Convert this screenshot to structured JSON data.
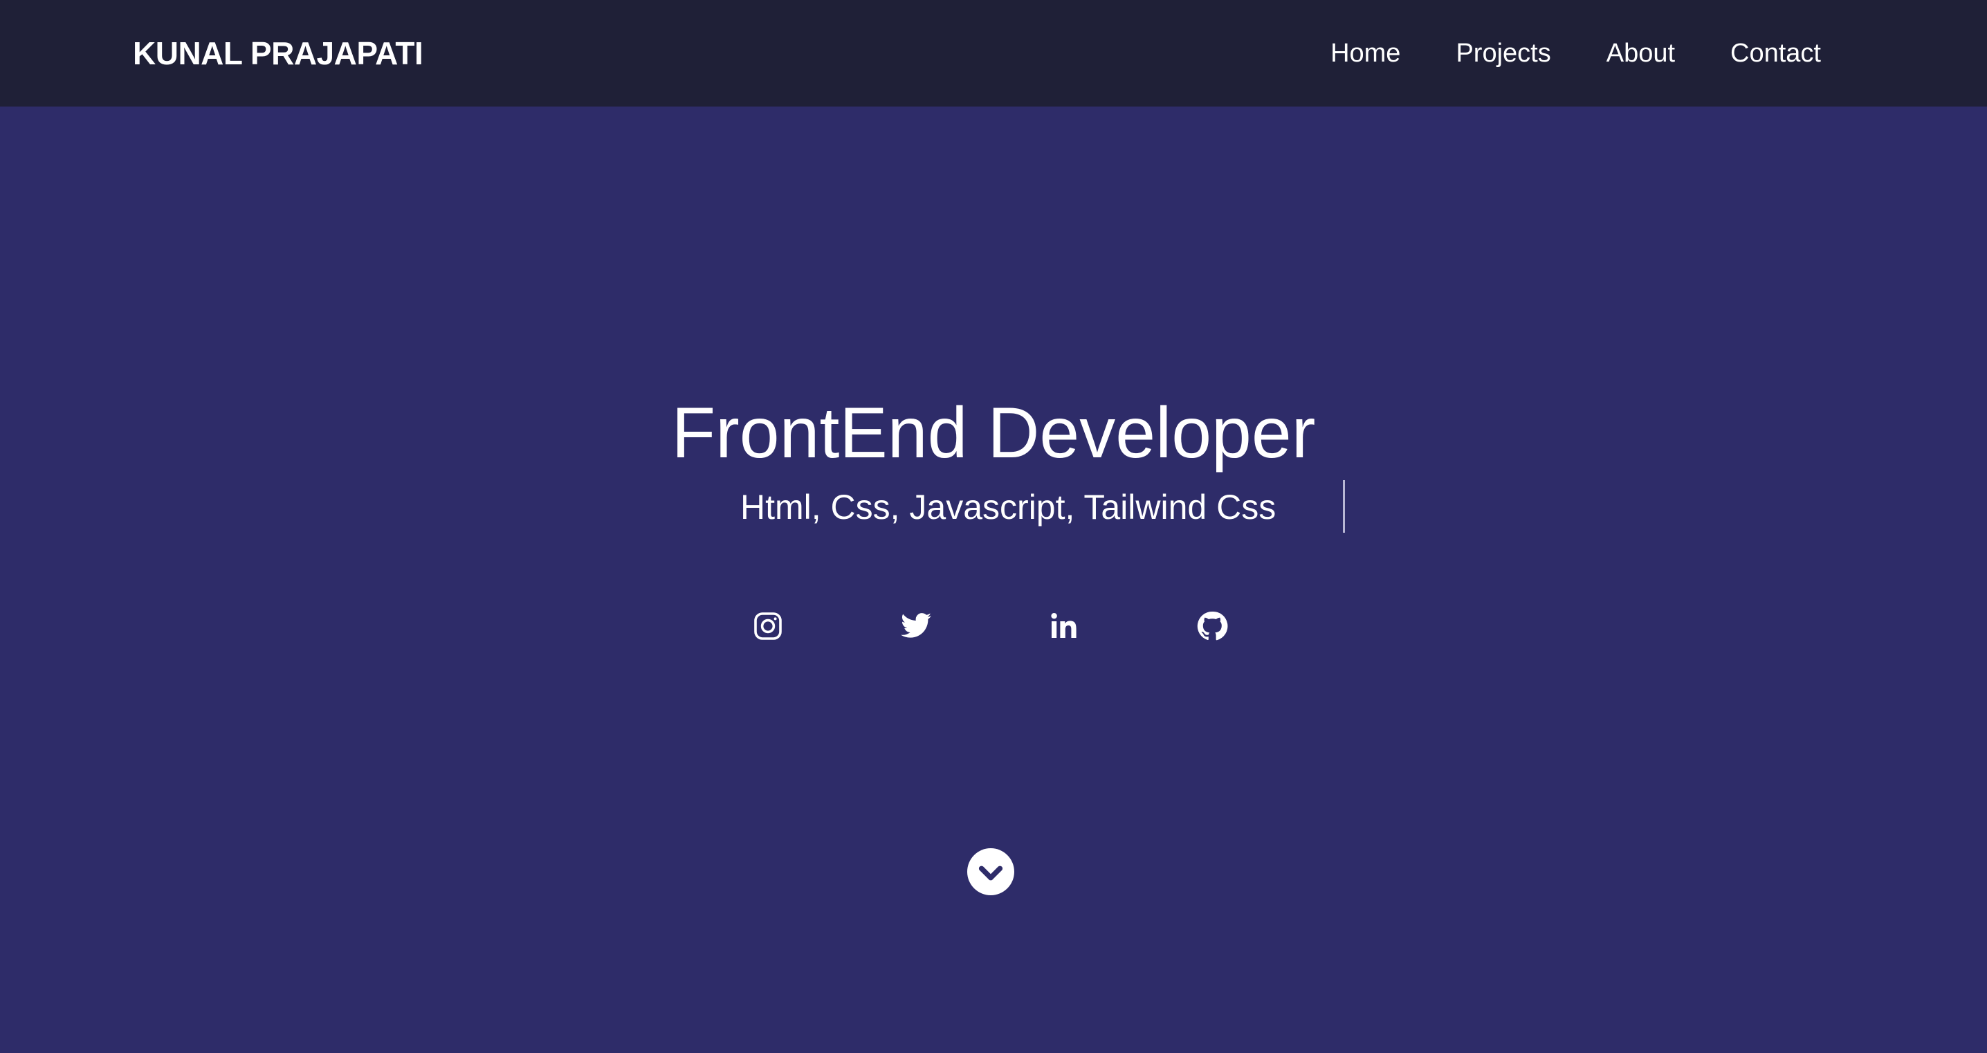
{
  "nav": {
    "brand": "KUNAL PRAJAPATI",
    "links": [
      "Home",
      "Projects",
      "About",
      "Contact"
    ]
  },
  "hero": {
    "title": "FrontEnd Developer",
    "subtitle": "Html, Css, Javascript, Tailwind Css"
  },
  "social": {
    "icons": [
      "instagram-icon",
      "twitter-icon",
      "linkedin-icon",
      "github-icon"
    ]
  },
  "scroll": {
    "icon": "chevron-down-circle-icon"
  },
  "colors": {
    "navbar_bg": "#1f2037",
    "hero_bg": "#2e2c69",
    "text": "#ffffff"
  }
}
